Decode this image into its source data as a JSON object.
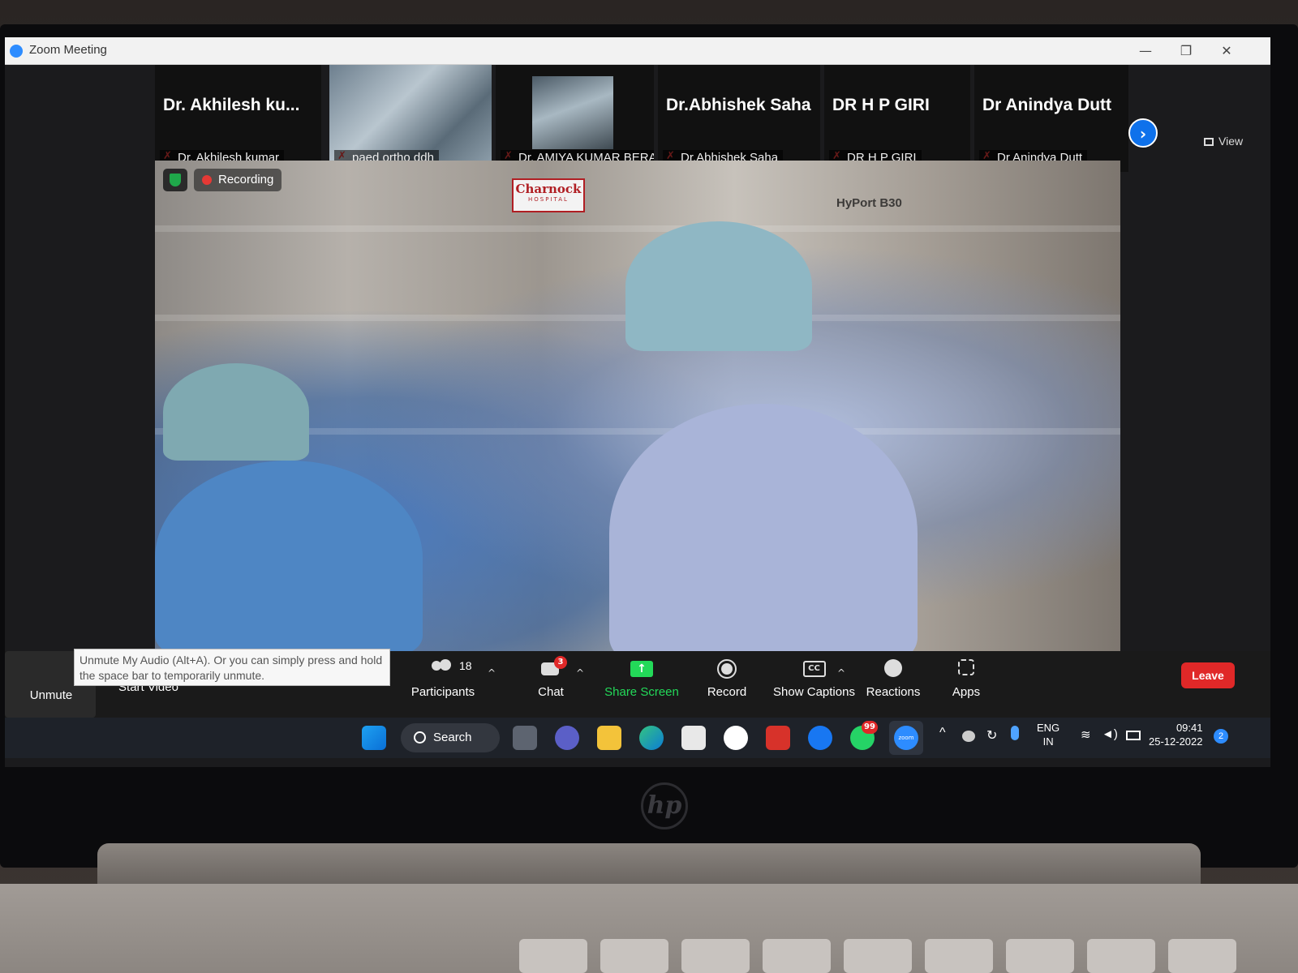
{
  "window": {
    "title": "Zoom Meeting",
    "controls": [
      "—",
      "❐",
      "✕"
    ]
  },
  "participants_strip": [
    {
      "display_name": "Dr.  Akhilesh ku...",
      "label": "Dr.  Akhilesh kumar",
      "has_video": false
    },
    {
      "display_name": "",
      "label": "paed ortho ddh",
      "has_video": true
    },
    {
      "display_name": "",
      "label": "Dr. AMIYA KUMAR BERA",
      "has_video": true
    },
    {
      "display_name": "Dr.Abhishek Saha",
      "label": "Dr.Abhishek Saha",
      "has_video": false
    },
    {
      "display_name": "DR H P GIRI",
      "label": "DR H P GIRI",
      "has_video": false
    },
    {
      "display_name": "Dr Anindya Dutt",
      "label": "Dr Anindya Dutt",
      "has_video": false
    }
  ],
  "view_button": "View",
  "main_video": {
    "recording_label": "Recording",
    "sign_text_1": "Charnock",
    "sign_text_2": "HOSPITAL",
    "equipment_label": "HyPort B30"
  },
  "tooltip": "Unmute My Audio (Alt+A). Or you can simply press and hold the space bar to temporarily unmute.",
  "toolbar": {
    "unmute": "Unmute",
    "start_video": "Start Video",
    "participants_label": "Participants",
    "participants_count": "18",
    "chat": "Chat",
    "chat_badge": "3",
    "share_screen": "Share Screen",
    "record": "Record",
    "show_captions": "Show Captions",
    "cc_icon_text": "CC",
    "reactions": "Reactions",
    "apps": "Apps",
    "leave": "Leave"
  },
  "taskbar": {
    "search": "Search",
    "whatsapp_badge": "99",
    "zoom_icon_text": "zoom",
    "lang_1": "ENG",
    "lang_2": "IN",
    "time": "09:41",
    "date": "25-12-2022",
    "notification_count": "2"
  },
  "accent_colors": {
    "zoom_blue": "#0e71eb",
    "leave_red": "#e02828",
    "share_green": "#23d959"
  }
}
